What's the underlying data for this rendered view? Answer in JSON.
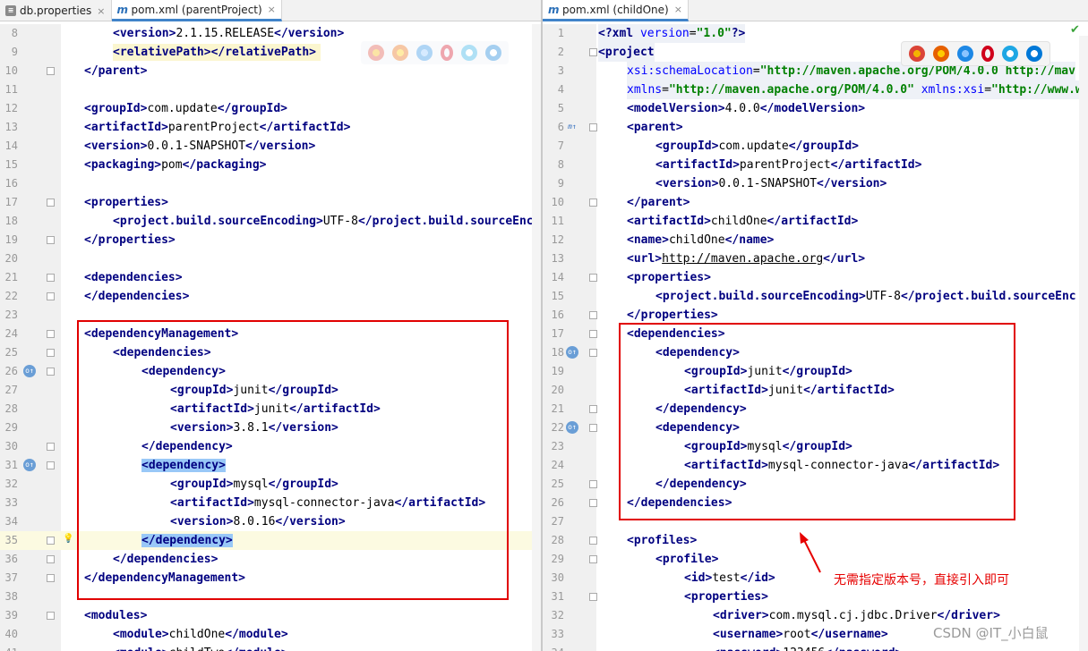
{
  "left_tabs": [
    {
      "label": "db.properties",
      "icon": "properties-file-icon"
    },
    {
      "label": "pom.xml (parentProject)",
      "icon": "maven-icon",
      "active": true
    }
  ],
  "right_tabs": [
    {
      "label": "pom.xml (childOne)",
      "icon": "maven-icon",
      "active": true
    }
  ],
  "left_lines": [
    {
      "n": "8",
      "indent": 1,
      "parts": [
        [
          "t",
          "<version>"
        ],
        [
          "tx",
          "2.1.15.RELEASE"
        ],
        [
          "t",
          "</version>"
        ]
      ]
    },
    {
      "n": "9",
      "indent": 1,
      "parts": [
        [
          "t",
          "<relativePath></relativePath>"
        ]
      ],
      "warn": true
    },
    {
      "n": "10",
      "indent": 0,
      "parts": [
        [
          "t",
          "</parent>"
        ]
      ],
      "fold": true
    },
    {
      "n": "11",
      "indent": 0,
      "parts": []
    },
    {
      "n": "12",
      "indent": 0,
      "parts": [
        [
          "t",
          "<groupId>"
        ],
        [
          "tx",
          "com.update"
        ],
        [
          "t",
          "</groupId>"
        ]
      ]
    },
    {
      "n": "13",
      "indent": 0,
      "parts": [
        [
          "t",
          "<artifactId>"
        ],
        [
          "tx",
          "parentProject"
        ],
        [
          "t",
          "</artifactId>"
        ]
      ]
    },
    {
      "n": "14",
      "indent": 0,
      "parts": [
        [
          "t",
          "<version>"
        ],
        [
          "tx",
          "0.0.1-SNAPSHOT"
        ],
        [
          "t",
          "</version>"
        ]
      ]
    },
    {
      "n": "15",
      "indent": 0,
      "parts": [
        [
          "t",
          "<packaging>"
        ],
        [
          "tx",
          "pom"
        ],
        [
          "t",
          "</packaging>"
        ]
      ]
    },
    {
      "n": "16",
      "indent": 0,
      "parts": []
    },
    {
      "n": "17",
      "indent": 0,
      "parts": [
        [
          "t",
          "<properties>"
        ]
      ],
      "fold": true
    },
    {
      "n": "18",
      "indent": 1,
      "parts": [
        [
          "t",
          "<project.build.sourceEncoding>"
        ],
        [
          "tx",
          "UTF-8"
        ],
        [
          "t",
          "</project.build.sourceEnc"
        ]
      ]
    },
    {
      "n": "19",
      "indent": 0,
      "parts": [
        [
          "t",
          "</properties>"
        ]
      ],
      "fold": true
    },
    {
      "n": "20",
      "indent": 0,
      "parts": []
    },
    {
      "n": "21",
      "indent": 0,
      "parts": [
        [
          "t",
          "<dependencies>"
        ]
      ],
      "fold": true
    },
    {
      "n": "22",
      "indent": 0,
      "parts": [
        [
          "t",
          "</dependencies>"
        ]
      ],
      "fold": true
    },
    {
      "n": "23",
      "indent": 0,
      "parts": []
    },
    {
      "n": "24",
      "indent": 0,
      "parts": [
        [
          "t",
          "<dependencyManagement>"
        ]
      ],
      "fold": true
    },
    {
      "n": "25",
      "indent": 1,
      "parts": [
        [
          "t",
          "<dependencies>"
        ]
      ],
      "fold": true
    },
    {
      "n": "26",
      "indent": 2,
      "parts": [
        [
          "t",
          "<dependency>"
        ]
      ],
      "fold": true,
      "gic": true
    },
    {
      "n": "27",
      "indent": 3,
      "parts": [
        [
          "t",
          "<groupId>"
        ],
        [
          "tx",
          "junit"
        ],
        [
          "t",
          "</groupId>"
        ]
      ]
    },
    {
      "n": "28",
      "indent": 3,
      "parts": [
        [
          "t",
          "<artifactId>"
        ],
        [
          "tx",
          "junit"
        ],
        [
          "t",
          "</artifactId>"
        ]
      ]
    },
    {
      "n": "29",
      "indent": 3,
      "parts": [
        [
          "t",
          "<version>"
        ],
        [
          "tx",
          "3.8.1"
        ],
        [
          "t",
          "</version>"
        ]
      ]
    },
    {
      "n": "30",
      "indent": 2,
      "parts": [
        [
          "t",
          "</dependency>"
        ]
      ],
      "fold": true
    },
    {
      "n": "31",
      "indent": 2,
      "parts": [
        [
          "hl",
          "<dependency>"
        ]
      ],
      "fold": true,
      "gic": true
    },
    {
      "n": "32",
      "indent": 3,
      "parts": [
        [
          "t",
          "<groupId>"
        ],
        [
          "tx",
          "mysql"
        ],
        [
          "t",
          "</groupId>"
        ]
      ]
    },
    {
      "n": "33",
      "indent": 3,
      "parts": [
        [
          "t",
          "<artifactId>"
        ],
        [
          "tx",
          "mysql-connector-java"
        ],
        [
          "t",
          "</artifactId>"
        ]
      ]
    },
    {
      "n": "34",
      "indent": 3,
      "parts": [
        [
          "t",
          "<version>"
        ],
        [
          "tx",
          "8.0.16"
        ],
        [
          "t",
          "</version>"
        ]
      ]
    },
    {
      "n": "35",
      "indent": 2,
      "parts": [
        [
          "hl",
          "</dependency>"
        ]
      ],
      "fold": true,
      "cur": true,
      "bulb": true
    },
    {
      "n": "36",
      "indent": 1,
      "parts": [
        [
          "t",
          "</dependencies>"
        ]
      ],
      "fold": true
    },
    {
      "n": "37",
      "indent": 0,
      "parts": [
        [
          "t",
          "</dependencyManagement>"
        ]
      ],
      "fold": true
    },
    {
      "n": "38",
      "indent": 0,
      "parts": []
    },
    {
      "n": "39",
      "indent": 0,
      "parts": [
        [
          "t",
          "<modules>"
        ]
      ],
      "fold": true
    },
    {
      "n": "40",
      "indent": 1,
      "parts": [
        [
          "t",
          "<module>"
        ],
        [
          "tx",
          "childOne"
        ],
        [
          "t",
          "</module>"
        ]
      ]
    },
    {
      "n": "41",
      "indent": 1,
      "parts": [
        [
          "t",
          "<module>"
        ],
        [
          "tx",
          "childTwo"
        ],
        [
          "t",
          "</module>"
        ]
      ]
    }
  ],
  "right_lines": [
    {
      "n": "1",
      "indent": 0,
      "parts": [
        [
          "t",
          "<?xml "
        ],
        [
          "at",
          "version"
        ],
        [
          "tx",
          "="
        ],
        [
          "av",
          "\"1.0\""
        ],
        [
          "t",
          "?>"
        ]
      ],
      "dif": true
    },
    {
      "n": "2",
      "indent": 0,
      "parts": [
        [
          "t",
          "<project"
        ]
      ],
      "fold": true,
      "dif": true
    },
    {
      "n": "3",
      "indent": 1,
      "parts": [
        [
          "at",
          "xsi:schemaLocation"
        ],
        [
          "tx",
          "="
        ],
        [
          "av",
          "\"http://maven.apache.org/POM/4.0.0 http://mav"
        ]
      ],
      "dif": true
    },
    {
      "n": "4",
      "indent": 1,
      "parts": [
        [
          "at",
          "xmlns"
        ],
        [
          "tx",
          "="
        ],
        [
          "av",
          "\"http://maven.apache.org/POM/4.0.0\""
        ],
        [
          "tx",
          " "
        ],
        [
          "at",
          "xmlns:xsi"
        ],
        [
          "tx",
          "="
        ],
        [
          "av",
          "\"http://www.w"
        ]
      ],
      "dif": true
    },
    {
      "n": "5",
      "indent": 1,
      "parts": [
        [
          "t",
          "<modelVersion>"
        ],
        [
          "tx",
          "4.0.0"
        ],
        [
          "t",
          "</modelVersion>"
        ]
      ]
    },
    {
      "n": "6",
      "indent": 1,
      "parts": [
        [
          "t",
          "<parent>"
        ]
      ],
      "fold": true,
      "mi": true
    },
    {
      "n": "7",
      "indent": 2,
      "parts": [
        [
          "t",
          "<groupId>"
        ],
        [
          "tx",
          "com.update"
        ],
        [
          "t",
          "</groupId>"
        ]
      ]
    },
    {
      "n": "8",
      "indent": 2,
      "parts": [
        [
          "t",
          "<artifactId>"
        ],
        [
          "tx",
          "parentProject"
        ],
        [
          "t",
          "</artifactId>"
        ]
      ]
    },
    {
      "n": "9",
      "indent": 2,
      "parts": [
        [
          "t",
          "<version>"
        ],
        [
          "tx",
          "0.0.1-SNAPSHOT"
        ],
        [
          "t",
          "</version>"
        ]
      ]
    },
    {
      "n": "10",
      "indent": 1,
      "parts": [
        [
          "t",
          "</parent>"
        ]
      ],
      "fold": true
    },
    {
      "n": "11",
      "indent": 1,
      "parts": [
        [
          "t",
          "<artifactId>"
        ],
        [
          "tx",
          "childOne"
        ],
        [
          "t",
          "</artifactId>"
        ]
      ]
    },
    {
      "n": "12",
      "indent": 1,
      "parts": [
        [
          "t",
          "<name>"
        ],
        [
          "tx",
          "childOne"
        ],
        [
          "t",
          "</name>"
        ]
      ]
    },
    {
      "n": "13",
      "indent": 1,
      "parts": [
        [
          "t",
          "<url>"
        ],
        [
          "u",
          "http://maven.apache.org"
        ],
        [
          "t",
          "</url>"
        ]
      ]
    },
    {
      "n": "14",
      "indent": 1,
      "parts": [
        [
          "t",
          "<properties>"
        ]
      ],
      "fold": true
    },
    {
      "n": "15",
      "indent": 2,
      "parts": [
        [
          "t",
          "<project.build.sourceEncoding>"
        ],
        [
          "tx",
          "UTF-8"
        ],
        [
          "t",
          "</project.build.sourceEnc"
        ]
      ]
    },
    {
      "n": "16",
      "indent": 1,
      "parts": [
        [
          "t",
          "</properties>"
        ]
      ],
      "fold": true
    },
    {
      "n": "17",
      "indent": 1,
      "parts": [
        [
          "t",
          "<dependencies>"
        ]
      ],
      "fold": true
    },
    {
      "n": "18",
      "indent": 2,
      "parts": [
        [
          "t",
          "<dependency>"
        ]
      ],
      "fold": true,
      "gic": true
    },
    {
      "n": "19",
      "indent": 3,
      "parts": [
        [
          "t",
          "<groupId>"
        ],
        [
          "tx",
          "junit"
        ],
        [
          "t",
          "</groupId>"
        ]
      ]
    },
    {
      "n": "20",
      "indent": 3,
      "parts": [
        [
          "t",
          "<artifactId>"
        ],
        [
          "tx",
          "junit"
        ],
        [
          "t",
          "</artifactId>"
        ]
      ]
    },
    {
      "n": "21",
      "indent": 2,
      "parts": [
        [
          "t",
          "</dependency>"
        ]
      ],
      "fold": true
    },
    {
      "n": "22",
      "indent": 2,
      "parts": [
        [
          "t",
          "<dependency>"
        ]
      ],
      "fold": true,
      "gic": true
    },
    {
      "n": "23",
      "indent": 3,
      "parts": [
        [
          "t",
          "<groupId>"
        ],
        [
          "tx",
          "mysql"
        ],
        [
          "t",
          "</groupId>"
        ]
      ]
    },
    {
      "n": "24",
      "indent": 3,
      "parts": [
        [
          "t",
          "<artifactId>"
        ],
        [
          "tx",
          "mysql-connector-java"
        ],
        [
          "t",
          "</artifactId>"
        ]
      ]
    },
    {
      "n": "25",
      "indent": 2,
      "parts": [
        [
          "t",
          "</dependency>"
        ]
      ],
      "fold": true
    },
    {
      "n": "26",
      "indent": 1,
      "parts": [
        [
          "t",
          "</dependencies>"
        ]
      ],
      "fold": true
    },
    {
      "n": "27",
      "indent": 0,
      "parts": []
    },
    {
      "n": "28",
      "indent": 1,
      "parts": [
        [
          "t",
          "<profiles>"
        ]
      ],
      "fold": true
    },
    {
      "n": "29",
      "indent": 2,
      "parts": [
        [
          "t",
          "<profile>"
        ]
      ],
      "fold": true
    },
    {
      "n": "30",
      "indent": 3,
      "parts": [
        [
          "t",
          "<id>"
        ],
        [
          "tx",
          "test"
        ],
        [
          "t",
          "</id>"
        ]
      ]
    },
    {
      "n": "31",
      "indent": 3,
      "parts": [
        [
          "t",
          "<properties>"
        ]
      ],
      "fold": true
    },
    {
      "n": "32",
      "indent": 4,
      "parts": [
        [
          "t",
          "<driver>"
        ],
        [
          "tx",
          "com.mysql.cj.jdbc.Driver"
        ],
        [
          "t",
          "</driver>"
        ]
      ]
    },
    {
      "n": "33",
      "indent": 4,
      "parts": [
        [
          "t",
          "<username>"
        ],
        [
          "tx",
          "root"
        ],
        [
          "t",
          "</username>"
        ]
      ]
    },
    {
      "n": "34",
      "indent": 4,
      "parts": [
        [
          "t",
          "<password>"
        ],
        [
          "tx",
          "123456"
        ],
        [
          "t",
          "</password>"
        ]
      ]
    }
  ],
  "annotation": "无需指定版本号，直接引入即可",
  "watermark": "CSDN @IT_小白鼠",
  "colors": {
    "tag": "#000080",
    "attr": "#0000ff",
    "value": "#008000",
    "highlight": "#99c8f7",
    "box": "#e10000"
  }
}
